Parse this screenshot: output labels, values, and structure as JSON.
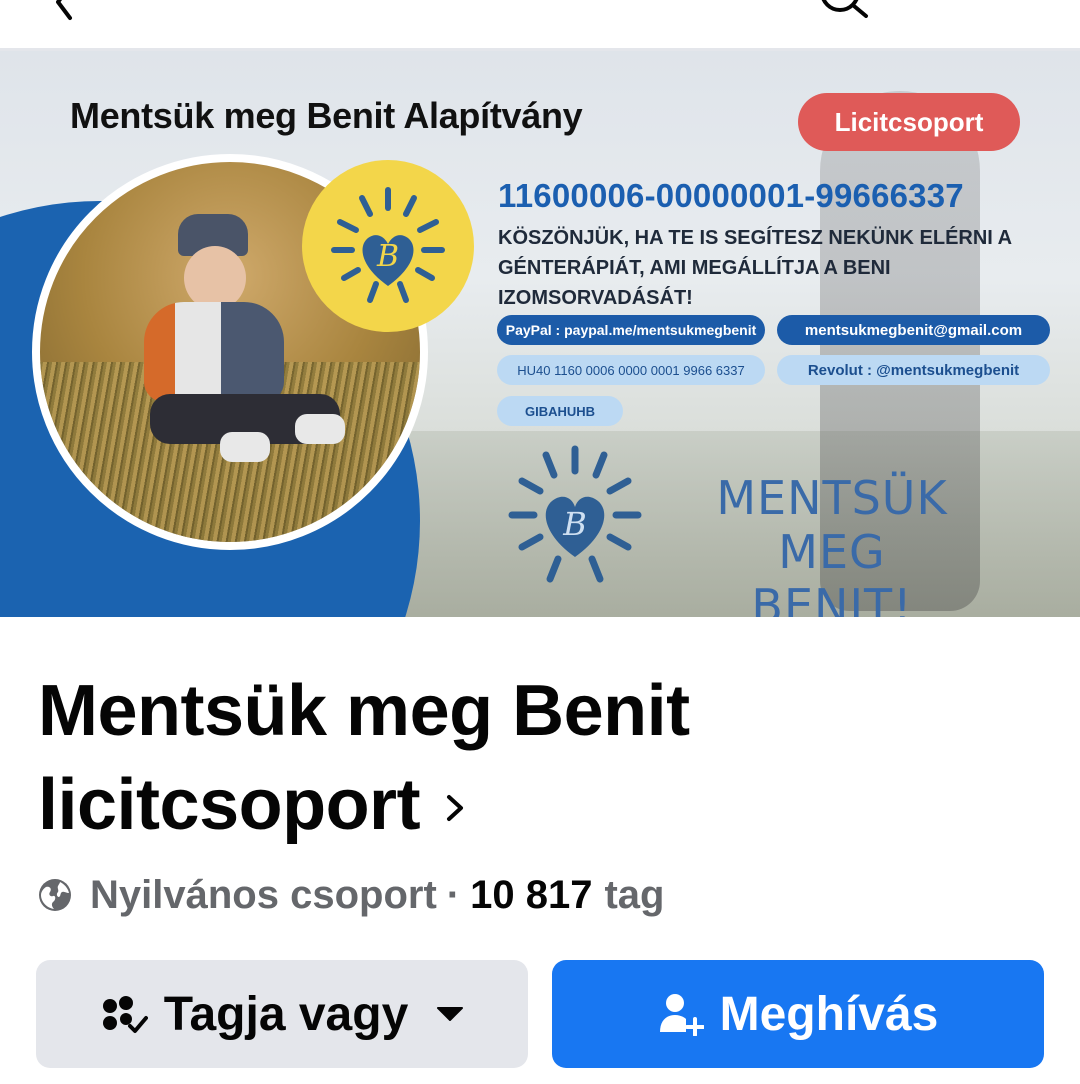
{
  "cover": {
    "org_name": "Mentsük meg Benit Alapítvány",
    "pill_label": "Licitcsoport",
    "account_number": "11600006-00000001-99666337",
    "message": "KÖSZÖNJÜK, HA TE IS SEGÍTESZ NEKÜNK ELÉRNI A GÉNTERÁPIÁT, AMI MEGÁLLÍTJA A BENI IZOMSORVADÁSÁT!",
    "paypal": "PayPal : paypal.me/mentsukmegbenit",
    "email": "mentsukmegbenit@gmail.com",
    "iban": "HU40 1160 0006 0000 0001 9966 6337",
    "revolut": "Revolut : @mentsukmegbenit",
    "swift": "GIBAHUHB",
    "logo_letter": "B",
    "slogan_line1": "MENTSÜK MEG",
    "slogan_line2": "BENIT!",
    "colors": {
      "blue": "#1b63b0",
      "yellow": "#f3d64a",
      "red": "#df5a58"
    }
  },
  "group": {
    "title": "Mentsük meg Benit licitcsoport",
    "privacy": "Nyilvános csoport",
    "separator": "·",
    "member_count": "10 817",
    "member_label": "tag"
  },
  "actions": {
    "member_button": "Tagja vagy",
    "invite_button": "Meghívás"
  },
  "icons": {
    "back": "back-arrow-icon",
    "search": "search-icon",
    "title_chevron": "chevron-right-icon",
    "privacy": "globe-icon",
    "member": "members-check-icon",
    "dropdown": "caret-down-icon",
    "invite": "person-add-icon"
  },
  "theme": {
    "accent": "#1877f2",
    "secondary_button": "#e4e6eb",
    "muted_text": "#65676b"
  }
}
